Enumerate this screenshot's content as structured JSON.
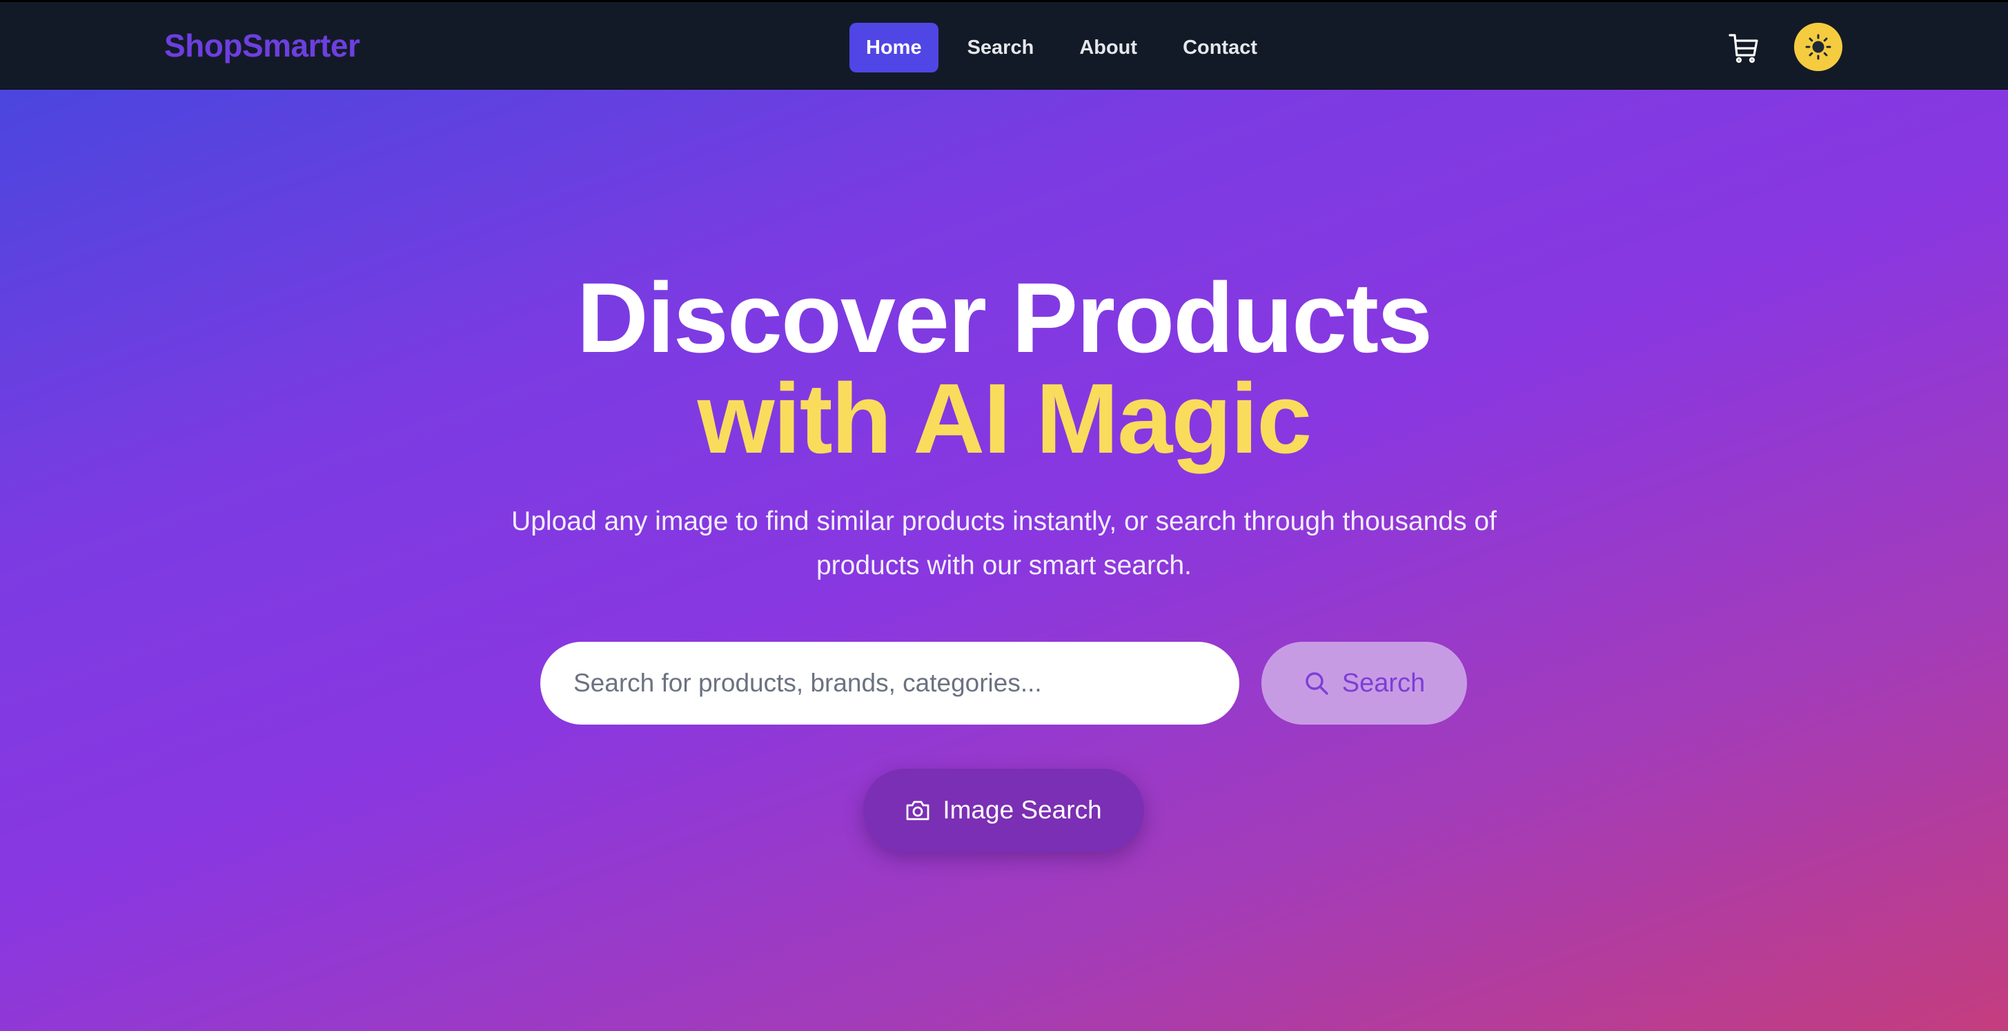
{
  "brand": {
    "name": "ShopSmarter"
  },
  "nav": {
    "items": [
      {
        "label": "Home",
        "active": true
      },
      {
        "label": "Search",
        "active": false
      },
      {
        "label": "About",
        "active": false
      },
      {
        "label": "Contact",
        "active": false
      }
    ]
  },
  "header_actions": {
    "cart_icon": "cart-icon",
    "theme_icon": "sun-icon"
  },
  "hero": {
    "headline_line1": "Discover Products",
    "headline_line2": "with AI Magic",
    "subtitle_line1": "Upload any image to find similar products instantly, or search through thousands of",
    "subtitle_line2": "products with our smart search.",
    "search": {
      "value": "",
      "placeholder": "Search for products, brands, categories..."
    },
    "search_button_label": "Search",
    "image_search_label": "Image Search"
  },
  "colors": {
    "nav_bg": "#131a27",
    "brand": "#6d3fe0",
    "nav_active": "#4f46e5",
    "highlight": "#f9dc5c",
    "theme_toggle": "#f5cc3f",
    "gradient_start": "#4b46de",
    "gradient_end": "#c43d7e"
  }
}
